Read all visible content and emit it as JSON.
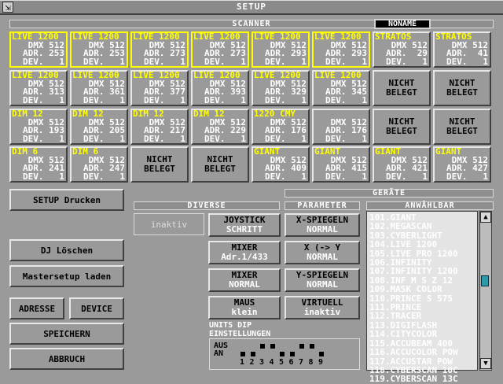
{
  "window": {
    "title": "SETUP",
    "close_glyph": "⇲"
  },
  "scanner": {
    "header": "SCANNER",
    "config_name": "NONAME",
    "tiles": [
      {
        "name": "LIVE 1200",
        "l1": "DMX 512",
        "l2": "ADR. 253",
        "l3": "DEV.   1",
        "selected": true
      },
      {
        "name": "LIVE 1200",
        "l1": "DMX 512",
        "l2": "ADR. 253",
        "l3": "DEV.   1",
        "selected": true
      },
      {
        "name": "LIVE 1200",
        "l1": "DMX 512",
        "l2": "ADR. 273",
        "l3": "DEV.   1",
        "selected": true
      },
      {
        "name": "LIVE 1200",
        "l1": "DMX 512",
        "l2": "ADR. 273",
        "l3": "DEV.   1",
        "selected": true
      },
      {
        "name": "LIVE 1200",
        "l1": "DMX 512",
        "l2": "ADR. 293",
        "l3": "DEV.   1",
        "selected": true
      },
      {
        "name": "LIVE 1200",
        "l1": "DMX 512",
        "l2": "ADR. 293",
        "l3": "DEV.   1",
        "selected": true
      },
      {
        "name": "STRATOS",
        "l1": "DMX 512",
        "l2": "ADR.  29",
        "l3": "DEV.   1",
        "selected": false
      },
      {
        "name": "STRATOS",
        "l1": "DMX 512",
        "l2": "ADR.  41",
        "l3": "DEV.   1",
        "selected": false
      },
      {
        "name": "LIVE 1200",
        "l1": "DMX 512",
        "l2": "ADR. 313",
        "l3": "DEV.   1",
        "selected": false
      },
      {
        "name": "LIVE 1200",
        "l1": "DMX 512",
        "l2": "ADR. 361",
        "l3": "DEV.   1",
        "selected": false
      },
      {
        "name": "LIVE 1200",
        "l1": "DMX 512",
        "l2": "ADR. 377",
        "l3": "DEV.   1",
        "selected": false
      },
      {
        "name": "LIVE 1200",
        "l1": "DMX 512",
        "l2": "ADR. 393",
        "l3": "DEV.   1",
        "selected": false
      },
      {
        "name": "LIVE 1200",
        "l1": "DMX 512",
        "l2": "ADR. 329",
        "l3": "DEV.   1",
        "selected": false
      },
      {
        "name": "LIVE 1200",
        "l1": "DMX 512",
        "l2": "ADR. 345",
        "l3": "DEV.   1",
        "selected": false
      },
      {
        "empty": true,
        "label": "NICHT BELEGT"
      },
      {
        "empty": true,
        "label": "NICHT BELEGT"
      },
      {
        "name": "DIM 12",
        "l1": "DMX 512",
        "l2": "ADR. 193",
        "l3": "DEV.   1",
        "selected": false
      },
      {
        "name": "DIM 12",
        "l1": "DMX 512",
        "l2": "ADR. 205",
        "l3": "DEV.   1",
        "selected": false
      },
      {
        "name": "DIM 12",
        "l1": "DMX 512",
        "l2": "ADR. 217",
        "l3": "DEV.   1",
        "selected": false
      },
      {
        "name": "DIM 12",
        "l1": "DMX 512",
        "l2": "ADR. 229",
        "l3": "DEV.   1",
        "selected": false
      },
      {
        "name": "1220 CMY",
        "l1": "DMX 512",
        "l2": "ADR. 176",
        "l3": "DEV.   1",
        "selected": false
      },
      {
        "name": "",
        "l1": "DMX 512",
        "l2": "ADR. 176",
        "l3": "DEV.   1",
        "selected": false
      },
      {
        "empty": true,
        "label": "NICHT BELEGT"
      },
      {
        "empty": true,
        "label": "NICHT BELEGT"
      },
      {
        "name": "DIM 6",
        "l1": "DMX 512",
        "l2": "ADR. 241",
        "l3": "DEV.   1",
        "selected": false
      },
      {
        "name": "DIM 6",
        "l1": "DMX 512",
        "l2": "ADR. 247",
        "l3": "DEV.   1",
        "selected": false
      },
      {
        "empty": true,
        "label": "NICHT BELEGT"
      },
      {
        "empty": true,
        "label": "NICHT BELEGT"
      },
      {
        "name": "GIANT",
        "l1": "DMX 512",
        "l2": "ADR. 409",
        "l3": "DEV.   1",
        "selected": false
      },
      {
        "name": "GIANT",
        "l1": "DMX 512",
        "l2": "ADR. 415",
        "l3": "DEV.   1",
        "selected": false
      },
      {
        "name": "GIANT",
        "l1": "DMX 512",
        "l2": "ADR. 421",
        "l3": "DEV.   1",
        "selected": false
      },
      {
        "name": "GIANT",
        "l1": "DMX 512",
        "l2": "ADR. 427",
        "l3": "DEV.   1",
        "selected": false
      }
    ]
  },
  "left_buttons": {
    "setup_print": "SETUP Drucken",
    "dj_delete": "DJ Löschen",
    "master_load": "Mastersetup laden",
    "address": "ADRESSE",
    "device": "DEVICE",
    "save": "SPEICHERN",
    "cancel": "ABBRUCH"
  },
  "diverse": {
    "header": "DIVERSE",
    "inactive_label": "inaktiv",
    "joystick": {
      "l1": "JOYSTICK",
      "l2": "SCHRITT"
    },
    "mixer1": {
      "l1": "MIXER",
      "l2": "Adr.1/433"
    },
    "mixer2": {
      "l1": "MIXER",
      "l2": "NORMAL"
    },
    "mouse": {
      "l1": "MAUS",
      "l2": "klein"
    }
  },
  "geraete": {
    "header": "GERÄTE"
  },
  "parameter": {
    "header": "PARAMETER",
    "xmirror": {
      "l1": "X-SPIEGELN",
      "l2": "NORMAL"
    },
    "xy": {
      "l1": "X (-> Y",
      "l2": "NORMAL"
    },
    "ymirror": {
      "l1": "Y-SPIEGELN",
      "l2": "NORMAL"
    },
    "virtual": {
      "l1": "VIRTUELL",
      "l2": "inaktiv"
    }
  },
  "dip": {
    "title_l1": "UNITS DIP",
    "title_l2": "EINSTELLUNGEN",
    "off_label": "AUS",
    "on_label": "AN",
    "numbers": [
      "1",
      "2",
      "3",
      "4",
      "5",
      "6",
      "7",
      "8",
      "9"
    ],
    "states": [
      0,
      0,
      1,
      1,
      0,
      0,
      1,
      1,
      0
    ]
  },
  "available": {
    "header": "ANWÄHLBAR",
    "items": [
      "101.GIANT",
      "102.MEGASCAN",
      "103.CYBERLIGHT",
      "104.LIVE 1200",
      "105.LIVE PRO 1200",
      "106.INFINITY",
      "107.INFINITY 1200",
      "108.INF M S Z 12",
      "109.MASK COLOR",
      "110.PRINCE S 575",
      "111.PRINCE",
      "112.TRACER",
      "113.DIGIFLASH",
      "114.CITYCOLOR",
      "115.ACCUBEAM 400",
      "116.ACCUCOLOR POW",
      "117.ACCUSTAR  POW",
      "118.CYBERSCAN 10C",
      "119.CYBERSCAN 13C"
    ],
    "scroll_up": "▲",
    "scroll_down": "▼"
  }
}
